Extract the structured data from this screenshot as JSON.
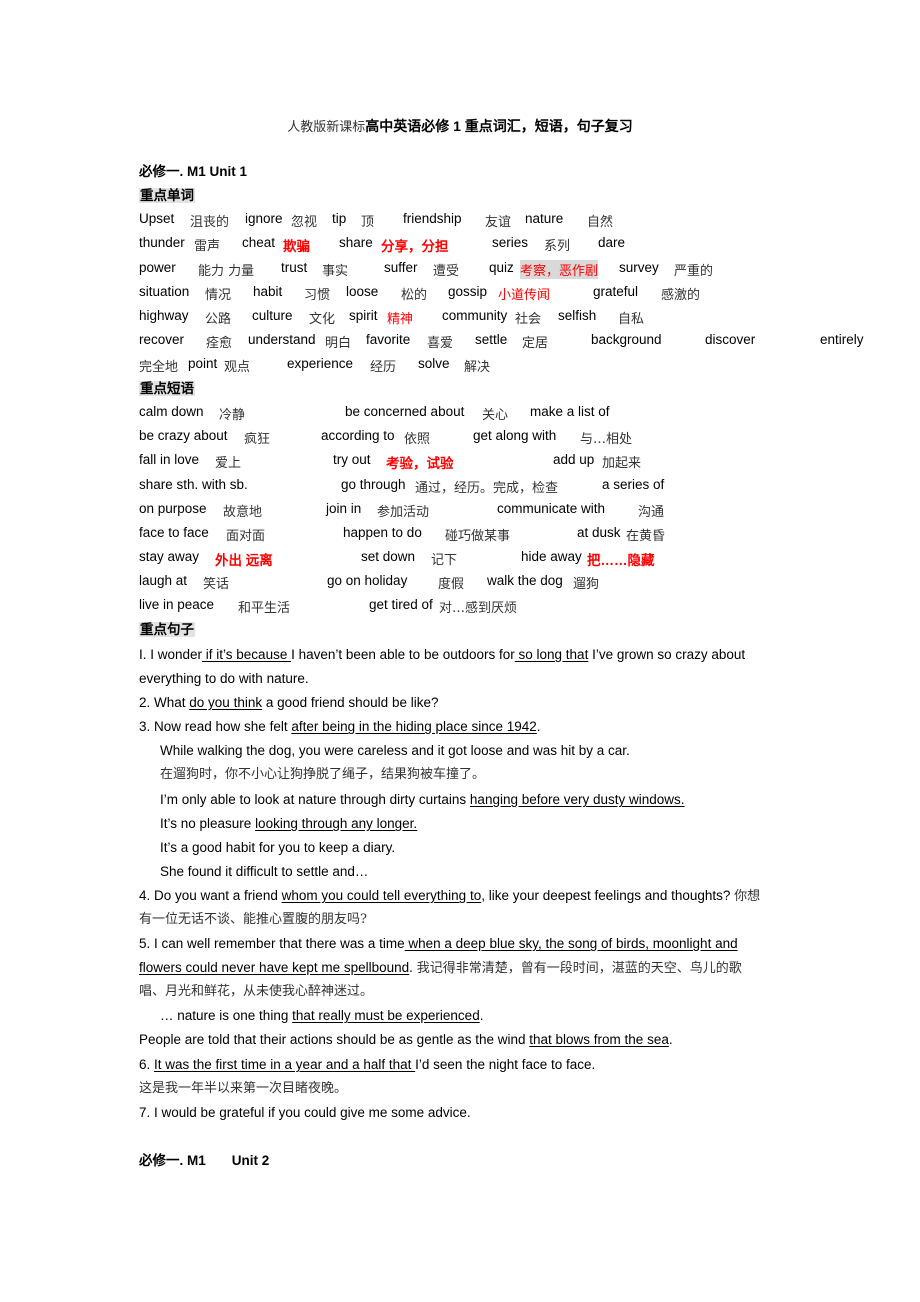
{
  "title": {
    "prefix": "人教版新课标",
    "main": "高中英语必修 1 重点词汇，短语，句子复习"
  },
  "unit1": {
    "heading": "必修一. M1 Unit 1",
    "vocab_heading": "重点单词",
    "vocab_rows": [
      [
        {
          "en": "Upset",
          "cn": "沮丧的"
        },
        {
          "en": "ignore",
          "cn": "忽视"
        },
        {
          "en": "tip",
          "cn": "顶"
        },
        {
          "en": "friendship",
          "cn": "友谊"
        },
        {
          "en": "nature",
          "cn": "自然"
        }
      ],
      [
        {
          "en": "thunder",
          "cn": "雷声"
        },
        {
          "en": "cheat",
          "cn": "欺骗"
        },
        {
          "en": "share",
          "cn": "分享，分担"
        },
        {
          "en": "series",
          "cn": "系列"
        },
        {
          "en": "dare",
          "cn": ""
        }
      ],
      [
        {
          "en": "power",
          "cn": "能力 力量"
        },
        {
          "en": "trust",
          "cn": "事实"
        },
        {
          "en": "suffer",
          "cn": "遭受"
        },
        {
          "en": "quiz",
          "cn": "考察，恶作剧"
        },
        {
          "en": "survey",
          "cn": "严重的"
        }
      ],
      [
        {
          "en": "situation",
          "cn": "情况"
        },
        {
          "en": "habit",
          "cn": "习惯"
        },
        {
          "en": "loose",
          "cn": "松的"
        },
        {
          "en": "gossip",
          "cn": "小道传闻"
        },
        {
          "en": "grateful",
          "cn": "感激的"
        }
      ],
      [
        {
          "en": "highway",
          "cn": "公路"
        },
        {
          "en": "culture",
          "cn": "文化"
        },
        {
          "en": "spirit",
          "cn": "精神"
        },
        {
          "en": "community",
          "cn": "社会"
        },
        {
          "en": "selfish",
          "cn": "自私"
        }
      ],
      [
        {
          "en": "recover",
          "cn": "痊愈"
        },
        {
          "en": "understand",
          "cn": "明白"
        },
        {
          "en": "favorite",
          "cn": "喜爱"
        },
        {
          "en": "settle",
          "cn": "定居"
        },
        {
          "en": "background",
          "cn": ""
        },
        {
          "en": "discover",
          "cn": ""
        },
        {
          "en": "entirely",
          "cn": ""
        }
      ],
      [
        {
          "en": "",
          "cn": "完全地"
        },
        {
          "en": "point",
          "cn": "观点"
        },
        {
          "en": "experience",
          "cn": "经历"
        },
        {
          "en": "solve",
          "cn": "解决"
        }
      ]
    ],
    "phrase_heading": "重点短语",
    "phrase_rows": [
      [
        {
          "en": "calm down",
          "cn": "冷静"
        },
        {
          "en": "be concerned about",
          "cn": "关心"
        },
        {
          "en": "make a list of",
          "cn": ""
        }
      ],
      [
        {
          "en": "be crazy about",
          "cn": "疯狂"
        },
        {
          "en": "according to",
          "cn": "依照"
        },
        {
          "en": "get along with",
          "cn": "与…相处"
        }
      ],
      [
        {
          "en": "fall in love",
          "cn": "爱上"
        },
        {
          "en": "try out",
          "cn": "考验，试验"
        },
        {
          "en": "add up",
          "cn": "加起来"
        }
      ],
      [
        {
          "en": "share sth. with sb.",
          "cn": ""
        },
        {
          "en": "go through",
          "cn": "通过，经历。完成，检查"
        },
        {
          "en": "a series of",
          "cn": ""
        }
      ],
      [
        {
          "en": "on purpose",
          "cn": "故意地"
        },
        {
          "en": "join in",
          "cn": "参加活动"
        },
        {
          "en": "communicate with",
          "cn": "沟通"
        }
      ],
      [
        {
          "en": "face to face",
          "cn": "面对面"
        },
        {
          "en": "happen to do",
          "cn": "碰巧做某事"
        },
        {
          "en": "at dusk",
          "cn": "在黄昏"
        }
      ],
      [
        {
          "en": "stay away",
          "cn": "外出 远离"
        },
        {
          "en": "set down",
          "cn": "记下"
        },
        {
          "en": "hide away",
          "cn": "把……隐藏"
        }
      ],
      [
        {
          "en": "laugh at",
          "cn": "笑话"
        },
        {
          "en": "go on holiday",
          "cn": "度假"
        },
        {
          "en": "walk the dog",
          "cn": "遛狗"
        }
      ],
      [
        {
          "en": "live in peace",
          "cn": "和平生活"
        },
        {
          "en": "get tired of",
          "cn": "对…感到厌烦"
        }
      ]
    ],
    "sentence_heading": "重点句子",
    "sentences": {
      "s1": {
        "a": "I. I wonder",
        "u1": " if it’s because ",
        "b": "I haven’t been able to be outdoors for",
        "u2": " so long that",
        "c": " I’ve grown so crazy about",
        "d": "everything to do with nature."
      },
      "s2": {
        "a": "2. What ",
        "u1": "do you think",
        "b": " a good friend should be like?"
      },
      "s3": {
        "a": "3. Now read how she felt ",
        "u1": "after being in the hiding place since 1942",
        "b": "."
      },
      "s3_sub": {
        "l1": "While walking the dog, you were careless and it got loose and was hit by a car.",
        "l2": "在遛狗时，你不小心让狗挣脱了绳子，结果狗被车撞了。",
        "l3a": "I’m only able to look at nature through dirty curtains ",
        "l3u": "hanging before very dusty windows.",
        "l4a": "It’s no pleasure ",
        "l4u": "looking through any longer.",
        "l5": "It’s a good habit for you to keep a diary.",
        "l6": "She found it difficult to settle and…"
      },
      "s4": {
        "a": "4. Do you want a friend ",
        "u1": "whom you could tell everything to",
        "b": ", like your deepest feelings and thoughts? ",
        "cn1": "你想",
        "cn2": "有一位无话不谈、能推心置腹的朋友吗?"
      },
      "s5": {
        "a": "5. I can well remember that there was a time",
        "u1": " when a deep blue sky, the song of birds, moonlight and",
        "u2": "flowers could never have kept me spellbound",
        "b": ". ",
        "cn1": "我记得非常清楚，曾有一段时间，湛蓝的天空、鸟儿的歌",
        "cn2": "唱、月光和鲜花，从未使我心醉神迷过。"
      },
      "s5_sub": {
        "a": "… nature is one thing ",
        "u1": "that really must be experienced",
        "b": "."
      },
      "s5_sub2": {
        "a": "People are told that their actions should be as gentle as the wind ",
        "u1": "that blows from the sea",
        "b": "."
      },
      "s6": {
        "a": "6. ",
        "u1": "It was the first time in a year and a half that ",
        "b": "I’d seen the night face to face.",
        "cn": "这是我一年半以来第一次目睹夜晚。"
      },
      "s7": {
        "a": "7. I would be grateful if you could give me some advice."
      }
    }
  },
  "unit2": {
    "heading_a": "必修一. M1",
    "heading_b": "Unit 2"
  }
}
